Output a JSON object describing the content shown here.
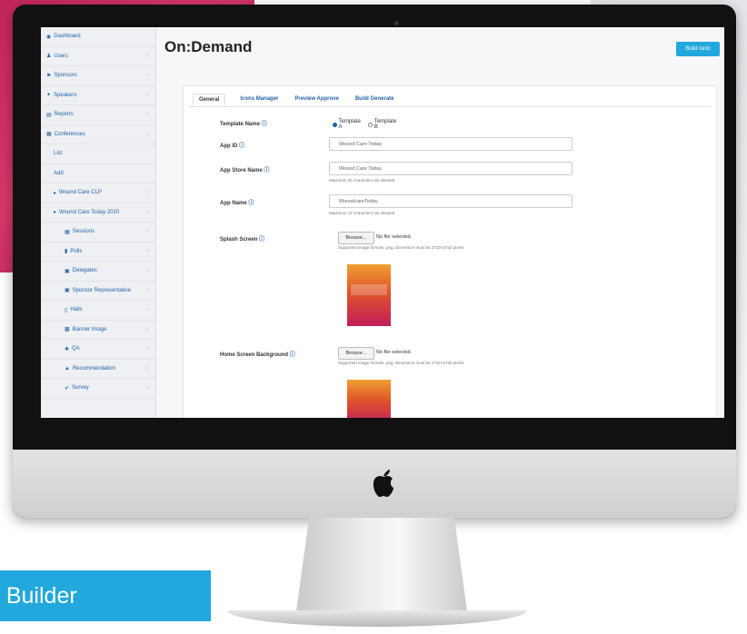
{
  "banner": {
    "text": "p Builder"
  },
  "sidebar": {
    "items": [
      {
        "label": "Dashboard",
        "icon": "dashboard-icon",
        "chevron": false,
        "level": 0
      },
      {
        "label": "Users",
        "icon": "user-icon",
        "chevron": true,
        "level": 0
      },
      {
        "label": "Sponsors",
        "icon": "sponsor-icon",
        "chevron": true,
        "level": 0
      },
      {
        "label": "Speakers",
        "icon": "speaker-icon",
        "chevron": true,
        "level": 0
      },
      {
        "label": "Reports",
        "icon": "report-icon",
        "chevron": true,
        "level": 0
      },
      {
        "label": "Conferences",
        "icon": "calendar-icon",
        "chevron": true,
        "level": 0
      },
      {
        "label": "List",
        "icon": "",
        "chevron": false,
        "level": 1
      },
      {
        "label": "Add",
        "icon": "",
        "chevron": false,
        "level": 1
      },
      {
        "label": "Wound Care CLP",
        "icon": "folder-icon",
        "chevron": true,
        "level": 1
      },
      {
        "label": "Wound Care Today 2020",
        "icon": "folder-icon",
        "chevron": true,
        "level": 1
      },
      {
        "label": "Sessions",
        "icon": "grid-icon",
        "chevron": true,
        "level": 2
      },
      {
        "label": "Polls",
        "icon": "chart-icon",
        "chevron": true,
        "level": 2
      },
      {
        "label": "Delegates",
        "icon": "people-icon",
        "chevron": true,
        "level": 2
      },
      {
        "label": "Sponsor Representative",
        "icon": "people-icon",
        "chevron": true,
        "level": 2
      },
      {
        "label": "Halls",
        "icon": "door-icon",
        "chevron": true,
        "level": 2
      },
      {
        "label": "Banner Image",
        "icon": "image-icon",
        "chevron": true,
        "level": 2
      },
      {
        "label": "QA",
        "icon": "qa-icon",
        "chevron": true,
        "level": 2
      },
      {
        "label": "Recommendation",
        "icon": "thumb-icon",
        "chevron": true,
        "level": 2
      },
      {
        "label": "Survey",
        "icon": "check-icon",
        "chevron": true,
        "level": 2
      }
    ]
  },
  "header": {
    "title": "On:Demand",
    "button_label": "Build Ionic"
  },
  "tabs": [
    "General",
    "Icons Manager",
    "Preview Approve",
    "Build Generate"
  ],
  "form": {
    "template_label": "Template Name",
    "template_options": [
      "Template A",
      "Template B"
    ],
    "app_id_label": "App ID",
    "app_id_value": "Wound Care Today",
    "store_name_label": "App Store Name",
    "store_name_value": "Wound Care Today",
    "store_name_hint": "Maximum 30 characters are allowed.",
    "app_name_label": "App Name",
    "app_name_value": "WoundcareToday",
    "app_name_hint": "Maximum 12 characters are allowed.",
    "splash_label": "Splash Screen",
    "splash_button": "Browse...",
    "splash_status": "No file selected.",
    "splash_hint": "Supported image formats .png. Dimension must be 2732×2732 pixels.",
    "home_bg_label": "Home Screen Background",
    "home_bg_button": "Browse...",
    "home_bg_status": "No file selected.",
    "home_bg_hint": "Supported image formats .png. Dimension must be 2732×2732 pixels."
  },
  "colors": {
    "accent": "#22a8dc",
    "link": "#2563a6",
    "brand_bg": "#c2255c"
  }
}
